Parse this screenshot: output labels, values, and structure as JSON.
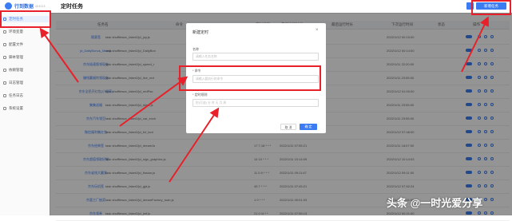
{
  "app": {
    "name": "行到数据",
    "version": "v2.5.0.3"
  },
  "page": {
    "title": "定时任务"
  },
  "toolbar": {
    "add_button_label": "新增任务"
  },
  "sidebar": {
    "items": [
      {
        "label": "定时任务",
        "active": true
      },
      {
        "label": "环境变量"
      },
      {
        "label": "配置文件"
      },
      {
        "label": "脚本管理"
      },
      {
        "label": "依赖管理"
      },
      {
        "label": "日志管理"
      },
      {
        "label": "任务日志"
      },
      {
        "label": "系统设置"
      }
    ]
  },
  "table": {
    "headers": [
      "任务名",
      "命令",
      "定时规则",
      "最后运行时间",
      "最后运行时长",
      "下次运行时间",
      "状态",
      "操作"
    ],
    "rows": [
      {
        "name": "随意签",
        "command": "task shufflewzc_faker2/jd_joy.js",
        "schedule": "",
        "last_run": "",
        "duration": "",
        "next_run": "2022/1/12 00:15:00"
      },
      {
        "name": "jd_DailyBonus_Mod.js",
        "command": "task shufflewzc_faker2/jd_DailyBon",
        "schedule": "",
        "last_run": "",
        "duration": "",
        "next_run": "2022/1/12 00:14:00"
      },
      {
        "name": "京东极速版领现金",
        "command": "task shufflewzc_faker2/jd_speed_r",
        "schedule": "",
        "last_run": "",
        "duration": "",
        "next_run": "2022/1/11 22:20:00"
      },
      {
        "name": "赚钱赢福利领现金",
        "command": "task shufflewzc_faker2/jd_live_red",
        "schedule": "",
        "last_run": "",
        "duration": "",
        "next_run": "2022/1/11 23:55:00"
      },
      {
        "name": "京东全民开红包(小程序)",
        "command": "task shufflewzc_faker2/jd_redPac",
        "schedule": "",
        "last_run": "",
        "duration": "",
        "next_run": "2022/1/12 01:00:00"
      },
      {
        "name": "集集送福",
        "command": "task shufflewzc_faker2/jd_ddnc.js",
        "schedule": "",
        "last_run": "",
        "duration": "",
        "next_run": "2022/1/11 23:55:00"
      },
      {
        "name": "京东汽车领豆",
        "command": "task shufflewzc_faker2/jd_car_exch",
        "schedule": "",
        "last_run": "",
        "duration": "",
        "next_run": "2022/1/11 23:55:00"
      },
      {
        "name": "微信福利集红包",
        "command": "task shufflewzc_faker2/jd_fcf_loot",
        "schedule": "",
        "last_run": "",
        "duration": "",
        "next_run": "2022/1/12 07:46:00"
      },
      {
        "name": "京东经典签",
        "command": "task shufflewzc_faker2/jd_dreamJs",
        "schedule": "17 7,18 * * *",
        "last_run": "2022/1/11 07:55:21",
        "duration": "",
        "next_run": "2022/1/11 18:07:00"
      },
      {
        "name": "京东超值领取好物",
        "command": "task shufflewzc_faker2/jd_sign_graphics.js",
        "schedule": "14 10 * * *",
        "last_run": "2022/1/11 10:14:09",
        "duration": "",
        "next_run": "2022/1/12 10:14:03"
      },
      {
        "name": "京东省钱大赢家",
        "command": "task shufflewzc_faker2/jd_fission.js",
        "schedule": "11 0,9 * * *",
        "last_run": "2022/1/11 09:11:47",
        "duration": "",
        "next_run": "2022/1/12 09:11:00"
      },
      {
        "name": "京东玩机签",
        "command": "task shufflewzc_faker2/jd_gjd.js",
        "schedule": "45 7 * * *",
        "last_run": "2022/1/11 07:45:21",
        "duration": "",
        "next_run": "2022/1/12 07:52:24"
      },
      {
        "name": "京喜工厂抽奖",
        "command": "task shufflewzc_faker2/jd_dreamFactory_tuan.js",
        "schedule": "1 0 * * *",
        "last_run": "2022/1/11 00:01:03",
        "duration": "",
        "next_run": "2022/1/12 00:01:00"
      },
      {
        "name": "京东领券",
        "command": "task shufflewzc_faker2/jd_jmf.js",
        "schedule": "21 0 /4 * *",
        "last_run": "2022/1/11 07:55:13",
        "duration": "",
        "next_run": "2022/1/12 00:21:00"
      }
    ]
  },
  "modal": {
    "title": "新建定时",
    "fields": [
      {
        "label": "名称",
        "required": false,
        "placeholder": "请输入任务名称"
      },
      {
        "label": "命令",
        "required": true,
        "placeholder": "请输入要执行的命令"
      },
      {
        "label": "定时规则",
        "required": true,
        "placeholder": "秒(可选) 分 时 天 月 周"
      }
    ],
    "cancel_label": "取 消",
    "ok_label": "确 定"
  },
  "watermark": {
    "text": "头条 @一时光爱分享"
  },
  "colors": {
    "accent": "#3b7cf2",
    "annotation": "#e8202a"
  }
}
